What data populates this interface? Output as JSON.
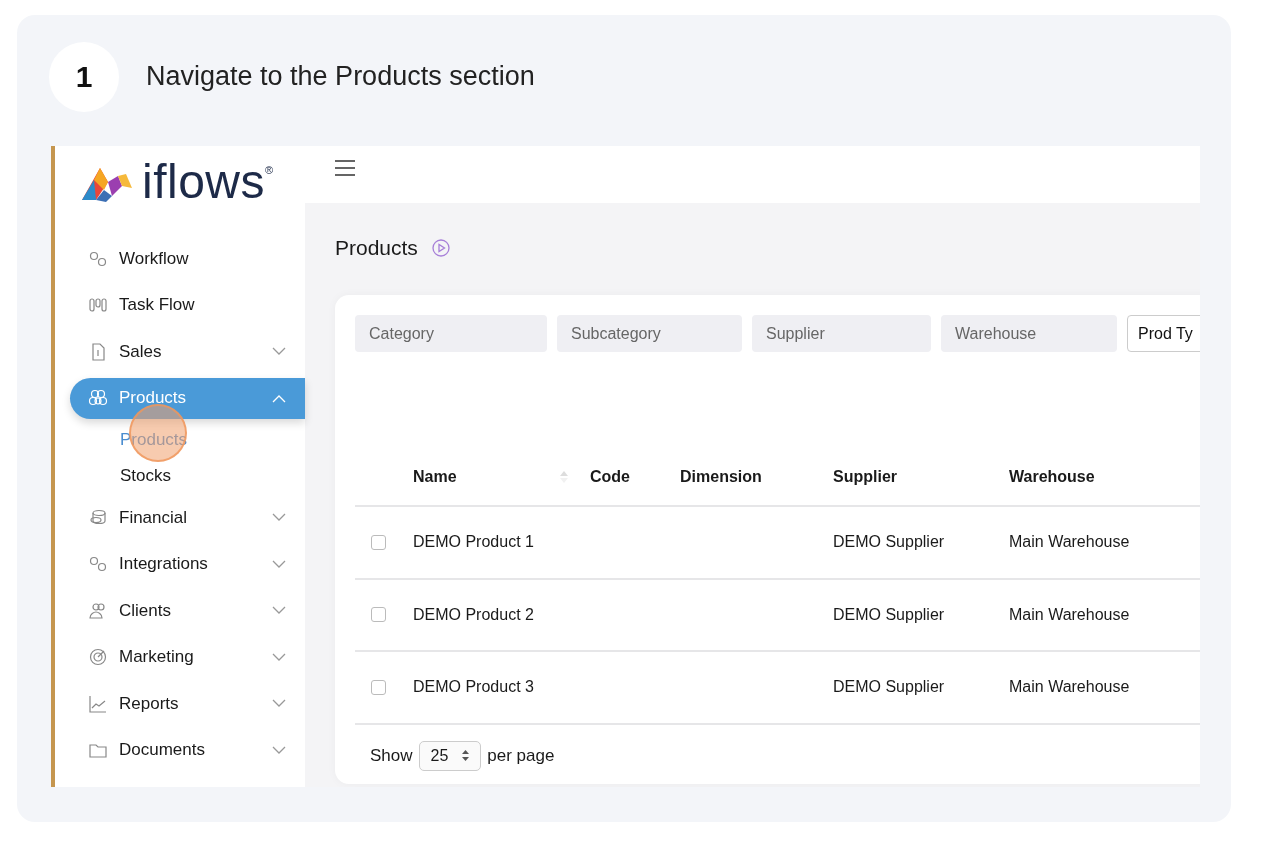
{
  "step": {
    "number": "1",
    "title": "Navigate to the Products section"
  },
  "logo": {
    "text": "iflows",
    "registered": "®"
  },
  "sidebar": {
    "items": [
      {
        "label": "Workflow",
        "selected": false
      },
      {
        "label": "Task Flow",
        "selected": false
      },
      {
        "label": "Sales",
        "selected": false,
        "expanded": false
      },
      {
        "label": "Products",
        "selected": true,
        "expanded": true,
        "children": [
          {
            "label": "Products",
            "selected": true
          },
          {
            "label": "Stocks",
            "selected": false
          }
        ]
      },
      {
        "label": "Financial",
        "selected": false,
        "expanded": false
      },
      {
        "label": "Integrations",
        "selected": false,
        "expanded": false
      },
      {
        "label": "Clients",
        "selected": false,
        "expanded": false
      },
      {
        "label": "Marketing",
        "selected": false,
        "expanded": false
      },
      {
        "label": "Reports",
        "selected": false,
        "expanded": false
      },
      {
        "label": "Documents",
        "selected": false,
        "expanded": false
      }
    ]
  },
  "page": {
    "title": "Products"
  },
  "filters": [
    {
      "kind": "field",
      "placeholder": "Category"
    },
    {
      "kind": "field",
      "placeholder": "Subcategory"
    },
    {
      "kind": "field",
      "placeholder": "Supplier"
    },
    {
      "kind": "field",
      "placeholder": "Warehouse"
    },
    {
      "kind": "select",
      "value": "Prod Ty"
    }
  ],
  "table": {
    "columns": [
      {
        "label": "Name",
        "sortable": true
      },
      {
        "label": "Code",
        "sortable": false
      },
      {
        "label": "Dimension",
        "sortable": false
      },
      {
        "label": "Supplier",
        "sortable": false
      },
      {
        "label": "Warehouse",
        "sortable": false
      }
    ],
    "rows": [
      {
        "checked": false,
        "name": "DEMO Product 1",
        "supplier": "DEMO Supplier",
        "warehouse": "Main Warehouse"
      },
      {
        "checked": false,
        "name": "DEMO Product 2",
        "supplier": "DEMO Supplier",
        "warehouse": "Main Warehouse"
      },
      {
        "checked": false,
        "name": "DEMO Product 3",
        "supplier": "DEMO Supplier",
        "warehouse": "Main Warehouse"
      }
    ]
  },
  "pagination": {
    "show_label": "Show",
    "per_page": "25",
    "per_page_label": "per page"
  }
}
